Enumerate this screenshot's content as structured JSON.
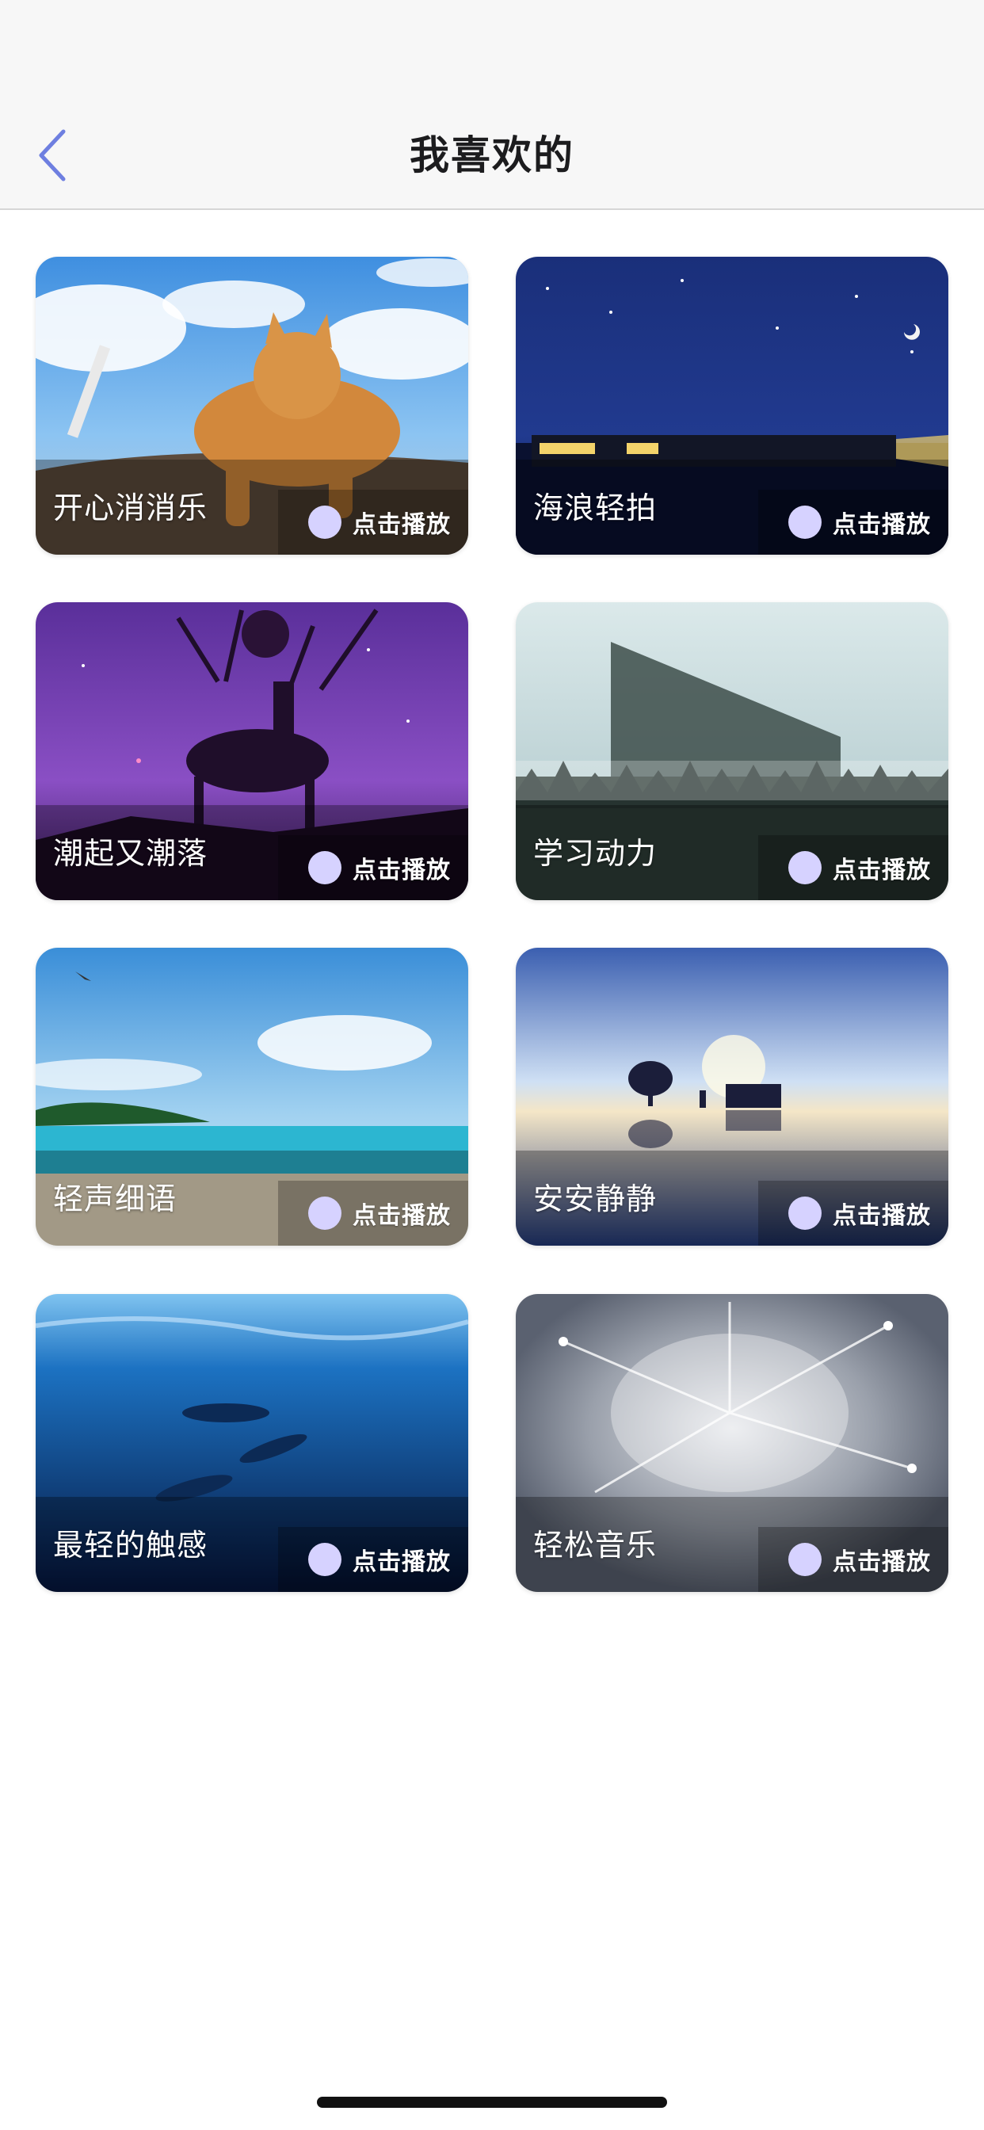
{
  "header": {
    "title": "我喜欢的",
    "back_icon": "chevron-left-icon",
    "accent": "#6e7fe0"
  },
  "play_label": "点击播放",
  "cards": [
    {
      "name": "开心消消乐",
      "scene": "cat on rocky shore under blue sky"
    },
    {
      "name": "海浪轻拍",
      "scene": "night train under starry sky with crescent moon"
    },
    {
      "name": "潮起又潮落",
      "scene": "deer silhouette on purple cosmic sky"
    },
    {
      "name": "学习动力",
      "scene": "misty pine forest with tilted slab"
    },
    {
      "name": "轻声细语",
      "scene": "tropical beach with island and seagulls"
    },
    {
      "name": "安安静静",
      "scene": "tree and piano reflected on water at dusk"
    },
    {
      "name": "最轻的触感",
      "scene": "dolphins swimming under blue ocean"
    },
    {
      "name": "轻松音乐",
      "scene": "fireworks smoke in gray sky"
    }
  ],
  "home_indicator": ""
}
